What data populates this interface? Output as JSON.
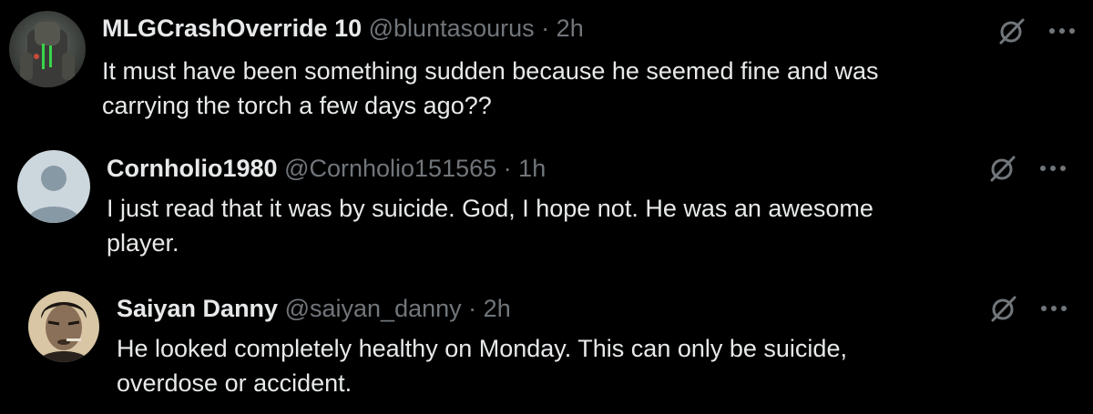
{
  "posts": [
    {
      "display_name": "MLGCrashOverride 10",
      "handle": "@bluntasourus",
      "separator": "·",
      "time": "2h",
      "text_line1": "It must have been something sudden because he seemed fine and was",
      "text_line2": "carrying the torch a few days ago??",
      "avatar_icon": "armored-character-avatar",
      "action_icon": "grok-slash-icon",
      "more_icon": "more-options-icon"
    },
    {
      "display_name": "Cornholio1980",
      "handle": "@Cornholio151565",
      "separator": "·",
      "time": "1h",
      "text_line1": "I just read that it was by suicide.  God, I hope not. He was an awesome",
      "text_line2": "player.",
      "avatar_icon": "default-profile-avatar",
      "action_icon": "grok-slash-icon",
      "more_icon": "more-options-icon"
    },
    {
      "display_name": "Saiyan Danny",
      "handle": "@saiyan_danny",
      "separator": "·",
      "time": "2h",
      "text_line1": "He looked completely healthy on Monday. This can only be suicide,",
      "text_line2": "overdose or accident.",
      "avatar_icon": "sepia-portrait-avatar",
      "action_icon": "grok-slash-icon",
      "more_icon": "more-options-icon"
    }
  ],
  "colors": {
    "background": "#000000",
    "primary_text": "#e7e9ea",
    "secondary_text": "#71767b"
  }
}
